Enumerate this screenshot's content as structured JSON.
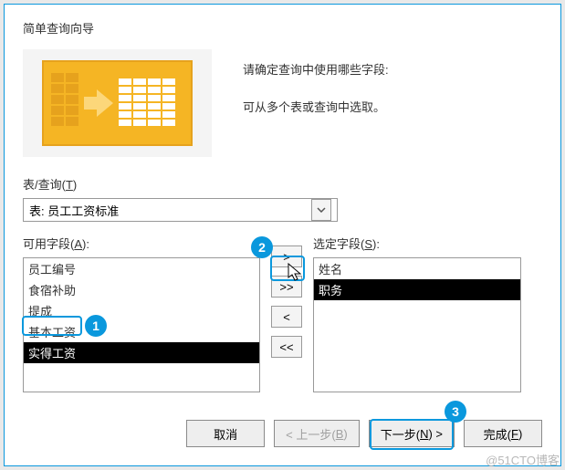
{
  "dialog": {
    "title": "简单查询向导",
    "instruction1": "请确定查询中使用哪些字段:",
    "instruction2": "可从多个表或查询中选取。"
  },
  "tableQuery": {
    "label": "表/查询(T)",
    "selected": "表: 员工工资标准"
  },
  "available": {
    "label": "可用字段(A):",
    "items": [
      "员工编号",
      "食宿补助",
      "提成",
      "基本工资",
      "实得工资"
    ],
    "selectedIndex": 4
  },
  "selected": {
    "label": "选定字段(S):",
    "items": [
      "姓名",
      "职务"
    ],
    "selectedIndex": 1
  },
  "moveButtons": {
    "addOne": ">",
    "addAll": ">>",
    "removeOne": "<",
    "removeAll": "<<"
  },
  "footerButtons": {
    "cancel": "取消",
    "back": "< 上一步(B)",
    "next": "下一步(N) >",
    "finish": "完成(F)"
  },
  "callouts": {
    "c1": "1",
    "c2": "2",
    "c3": "3"
  },
  "watermark": "@51CTO博客"
}
